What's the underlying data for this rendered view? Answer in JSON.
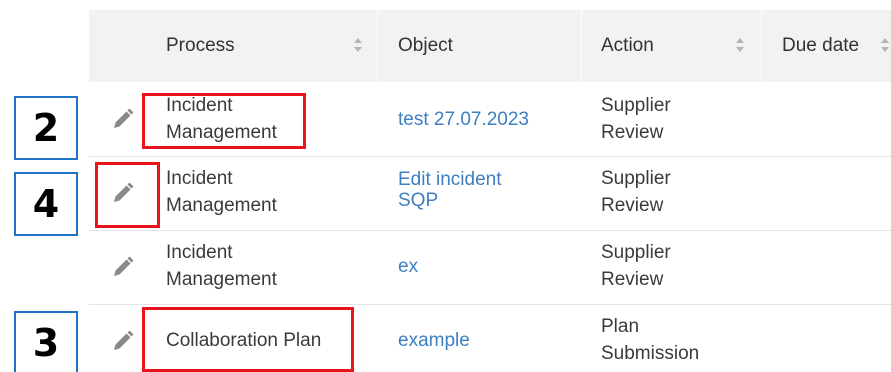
{
  "table": {
    "columns": [
      {
        "label": "Process",
        "sortable": true
      },
      {
        "label": "Object",
        "sortable": false
      },
      {
        "label": "Action",
        "sortable": true
      },
      {
        "label": "Due date",
        "sortable": true
      }
    ],
    "rows": [
      {
        "process": [
          "Incident",
          "Management"
        ],
        "object": [
          "test 27.07.2023"
        ],
        "action": [
          "Supplier",
          "Review"
        ],
        "due_date": ""
      },
      {
        "process": [
          "Incident",
          "Management"
        ],
        "object": [
          "Edit incident",
          "SQP"
        ],
        "action": [
          "Supplier",
          "Review"
        ],
        "due_date": ""
      },
      {
        "process": [
          "Incident",
          "Management"
        ],
        "object": [
          "ex"
        ],
        "action": [
          "Supplier",
          "Review"
        ],
        "due_date": ""
      },
      {
        "process": [
          "Collaboration Plan"
        ],
        "object": [
          "example"
        ],
        "action": [
          "Plan",
          "Submission"
        ],
        "due_date": ""
      }
    ]
  },
  "annotations": {
    "badges": [
      "2",
      "4",
      "3"
    ],
    "highlight_color": "#e8141b",
    "badge_border_color": "#1f74c6"
  },
  "colors": {
    "header_bg": "#f2f2f2",
    "link": "#3d7fc1",
    "text": "#3a3a3a",
    "icon": "#8a8a8a"
  },
  "icons": {
    "row_action": "pencil-icon",
    "sort": "sort-icon"
  }
}
